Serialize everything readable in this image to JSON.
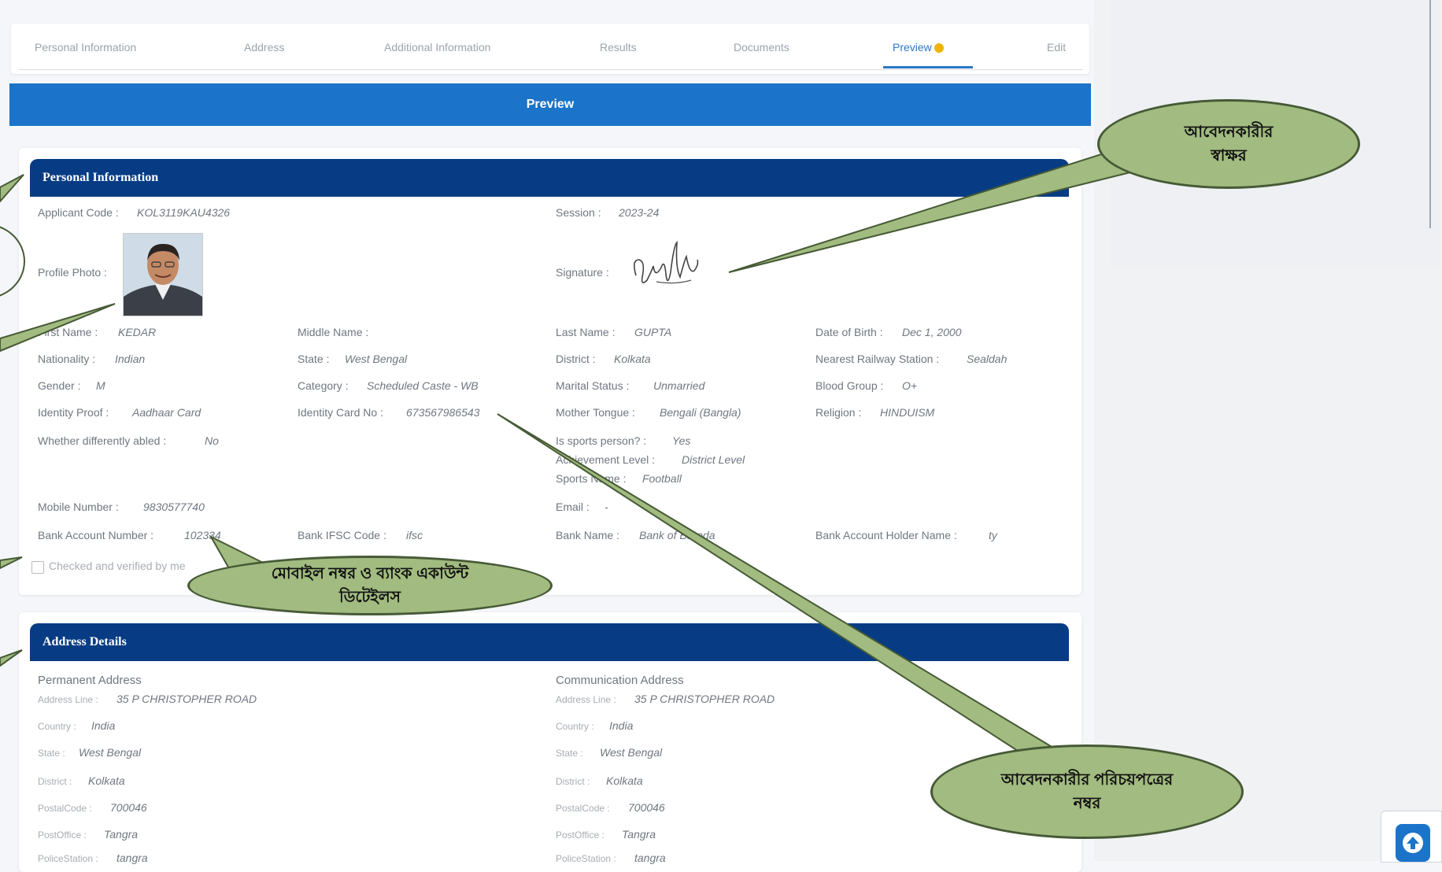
{
  "tabs": [
    "Personal Information",
    "Address",
    "Additional Information",
    "Results",
    "Documents",
    "Preview",
    "Edit"
  ],
  "preview_bar": "Preview",
  "personal": {
    "header": "Personal Information",
    "applicant_code_label": "Applicant Code :",
    "applicant_code": "KOL3119KAU4326",
    "session_label": "Session :",
    "session": "2023-24",
    "profile_photo_label": "Profile Photo :",
    "signature_label": "Signature :",
    "first_name_label": "First Name :",
    "first_name": "KEDAR",
    "middle_name_label": "Middle Name :",
    "middle_name": "",
    "last_name_label": "Last Name :",
    "last_name": "GUPTA",
    "dob_label": "Date of Birth :",
    "dob": "Dec 1, 2000",
    "nationality_label": "Nationality :",
    "nationality": "Indian",
    "state_label": "State :",
    "state": "West Bengal",
    "district_label": "District :",
    "district": "Kolkata",
    "railway_label": "Nearest Railway Station :",
    "railway": "Sealdah",
    "gender_label": "Gender :",
    "gender": "M",
    "category_label": "Category :",
    "category": "Scheduled Caste - WB",
    "marital_label": "Marital Status :",
    "marital": "Unmarried",
    "blood_label": "Blood Group :",
    "blood": "O+",
    "idproof_label": "Identity Proof :",
    "idproof": "Aadhaar Card",
    "idcard_label": "Identity Card No :",
    "idcard": "673567986543",
    "mother_tongue_label": "Mother Tongue :",
    "mother_tongue": "Bengali (Bangla)",
    "religion_label": "Religion :",
    "religion": "HINDUISM",
    "disabled_label": "Whether differently abled :",
    "disabled": "No",
    "sports_label": "Is sports person? :",
    "sports": "Yes",
    "achievement_label": "Achievement Level :",
    "achievement": "District Level",
    "sports_name_label": "Sports Name :",
    "sports_name": "Football",
    "mobile_label": "Mobile Number :",
    "mobile": "9830577740",
    "email_label": "Email :",
    "email": "-",
    "bank_acc_label": "Bank Account Number :",
    "bank_acc": "102334",
    "ifsc_label": "Bank IFSC Code :",
    "ifsc": "ifsc",
    "bank_name_label": "Bank Name :",
    "bank_name": "Bank of Baroda",
    "holder_label": "Bank Account Holder Name :",
    "holder": "ty",
    "checkbox_label": "Checked and verified by me"
  },
  "address": {
    "header": "Address Details",
    "permanent_title": "Permanent Address",
    "communication_title": "Communication Address",
    "labels": [
      "Address Line :",
      "Country :",
      "State :",
      "District :",
      "PostalCode :",
      "PostOffice :",
      "PoliceStation :"
    ],
    "permanent_values": [
      "35 P CHRISTOPHER ROAD",
      "India",
      "West Bengal",
      "Kolkata",
      "700046",
      "Tangra",
      "tangra"
    ],
    "communication_values": [
      "35 P CHRISTOPHER ROAD",
      "India",
      "West Bengal",
      "Kolkata",
      "700046",
      "Tangra",
      "tangra"
    ]
  },
  "annotations": {
    "signature": "আবেদনকারীর\nস্বাক্ষর",
    "bank": "মোবাইল নম্বর ও ব্যাংক একাউন্ট\nডিটেইলস",
    "id_card": "আবেদনকারীর পরিচয়পত্রের\nনম্বর",
    "color_fill": "#a2bb80",
    "color_border": "#465a36"
  },
  "icons": {
    "scroll_top": "arrow-up-icon"
  },
  "colors": {
    "primary": "#1b74c9",
    "header": "#073c84"
  }
}
